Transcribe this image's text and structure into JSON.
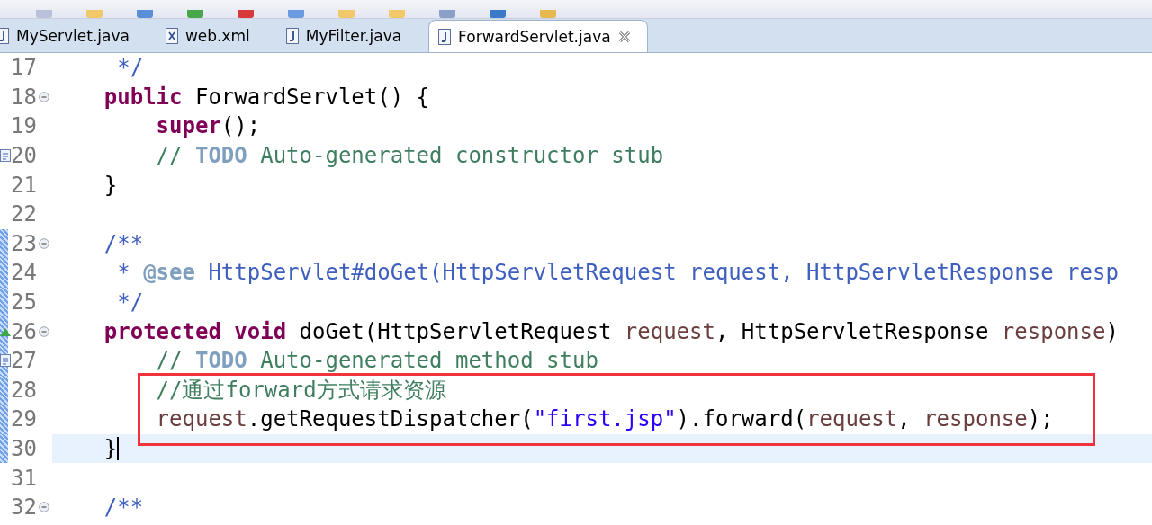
{
  "tabs": [
    {
      "label": "MyServlet.java",
      "kind": "java",
      "selected": false
    },
    {
      "label": "web.xml",
      "kind": "xml",
      "selected": false
    },
    {
      "label": "MyFilter.java",
      "kind": "java",
      "selected": false
    },
    {
      "label": "ForwardServlet.java",
      "kind": "java",
      "selected": true
    }
  ],
  "editor": {
    "lines": [
      {
        "number": "17",
        "kind": "plain",
        "fold": false,
        "changed": false,
        "current": false,
        "tokens": [
          {
            "kind": "javadoc",
            "text": "     */"
          }
        ]
      },
      {
        "number": "18",
        "kind": "plain",
        "fold": true,
        "changed": false,
        "current": false,
        "tokens": [
          {
            "kind": "keyword",
            "text": "    public"
          },
          {
            "kind": "plain",
            "text": " ForwardServlet() {"
          }
        ]
      },
      {
        "number": "19",
        "kind": "plain",
        "fold": false,
        "changed": false,
        "current": false,
        "tokens": [
          {
            "kind": "keyword",
            "text": "        super"
          },
          {
            "kind": "plain",
            "text": "();"
          }
        ]
      },
      {
        "number": "20",
        "kind": "task",
        "fold": false,
        "changed": false,
        "current": false,
        "tokens": [
          {
            "kind": "comment",
            "text": "        // "
          },
          {
            "kind": "todo",
            "text": "TODO"
          },
          {
            "kind": "comment",
            "text": " Auto-generated constructor stub"
          }
        ]
      },
      {
        "number": "21",
        "kind": "plain",
        "fold": false,
        "changed": false,
        "current": false,
        "tokens": [
          {
            "kind": "plain",
            "text": "    }"
          }
        ]
      },
      {
        "number": "22",
        "kind": "plain",
        "fold": false,
        "changed": false,
        "current": false
      },
      {
        "number": "23",
        "kind": "plain",
        "fold": true,
        "changed": true,
        "current": false,
        "tokens": [
          {
            "kind": "javadoc",
            "text": "    /**"
          }
        ]
      },
      {
        "number": "24",
        "kind": "plain",
        "fold": false,
        "changed": true,
        "current": false,
        "tokens": [
          {
            "kind": "javadoc",
            "text": "     * "
          },
          {
            "kind": "tag",
            "text": "@see"
          },
          {
            "kind": "javadoc",
            "text": " HttpServlet#doGet(HttpServletRequest request, HttpServletResponse resp"
          }
        ]
      },
      {
        "number": "25",
        "kind": "plain",
        "fold": false,
        "changed": true,
        "current": false,
        "tokens": [
          {
            "kind": "javadoc",
            "text": "     */"
          }
        ]
      },
      {
        "number": "26",
        "kind": "override",
        "fold": true,
        "changed": true,
        "current": false,
        "tokens": [
          {
            "kind": "keyword",
            "text": "    protected"
          },
          {
            "kind": "keyword",
            "text": " void"
          },
          {
            "kind": "plain",
            "text": " doGet(HttpServletRequest "
          },
          {
            "kind": "param",
            "text": "request"
          },
          {
            "kind": "plain",
            "text": ", HttpServletResponse "
          },
          {
            "kind": "param",
            "text": "response"
          },
          {
            "kind": "plain",
            "text": ")"
          }
        ]
      },
      {
        "number": "27",
        "kind": "task",
        "fold": false,
        "changed": true,
        "current": false,
        "tokens": [
          {
            "kind": "comment",
            "text": "        // "
          },
          {
            "kind": "todo",
            "text": "TODO"
          },
          {
            "kind": "comment",
            "text": " Auto-generated method stub"
          }
        ]
      },
      {
        "number": "28",
        "kind": "plain",
        "fold": false,
        "changed": true,
        "current": false,
        "tokens": [
          {
            "kind": "comment",
            "text": "        //通过forward方式请求资源"
          }
        ]
      },
      {
        "number": "29",
        "kind": "plain",
        "fold": false,
        "changed": true,
        "current": false,
        "tokens": [
          {
            "kind": "param",
            "text": "        request"
          },
          {
            "kind": "plain",
            "text": ".getRequestDispatcher("
          },
          {
            "kind": "string",
            "text": "\"first.jsp\""
          },
          {
            "kind": "plain",
            "text": ").forward("
          },
          {
            "kind": "param",
            "text": "request"
          },
          {
            "kind": "plain",
            "text": ", "
          },
          {
            "kind": "param",
            "text": "response"
          },
          {
            "kind": "plain",
            "text": ");"
          }
        ]
      },
      {
        "number": "30",
        "kind": "plain",
        "fold": false,
        "changed": true,
        "current": true,
        "tokens": [
          {
            "kind": "plain",
            "text": "    }"
          }
        ]
      },
      {
        "number": "31",
        "kind": "plain",
        "fold": false,
        "changed": false,
        "current": false
      },
      {
        "number": "32",
        "kind": "plain",
        "fold": true,
        "changed": false,
        "current": false,
        "tokens": [
          {
            "kind": "javadoc",
            "text": "    /**"
          }
        ]
      }
    ]
  }
}
